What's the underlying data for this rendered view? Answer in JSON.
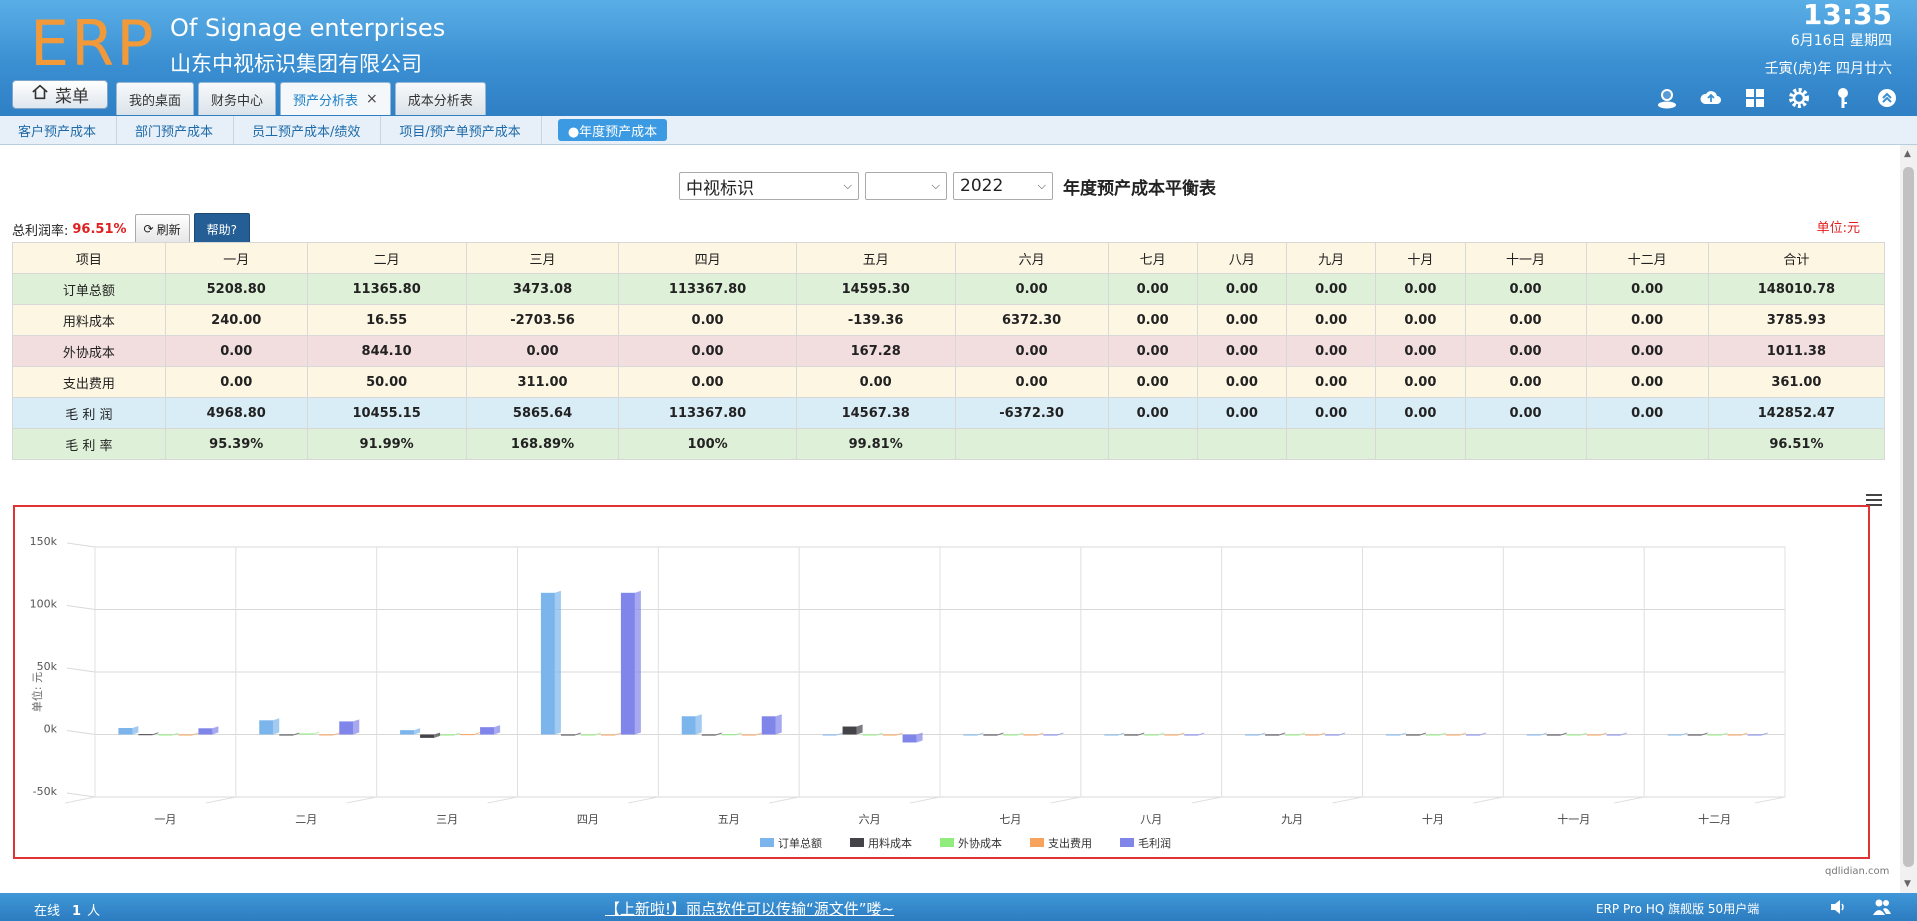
{
  "header": {
    "logo": "ERP",
    "company_en": "Of Signage enterprises",
    "company_cn": "山东中视标识集团有限公司",
    "time": "13:35",
    "date": "6月16日 星期四",
    "lunar": "壬寅(虎)年 四月廿六",
    "menu_label": "菜单",
    "tabs": [
      {
        "label": "我的桌面"
      },
      {
        "label": "财务中心"
      },
      {
        "label": "预产分析表",
        "close": "×"
      },
      {
        "label": "成本分析表"
      }
    ],
    "tool_icons": [
      "user-status-icon",
      "cloud-upload-icon",
      "apps-grid-icon",
      "settings-gear-icon",
      "key-icon",
      "collapse-up-icon"
    ]
  },
  "subnav": {
    "items": [
      "客户预产成本",
      "部门预产成本",
      "员工预产成本/绩效",
      "项目/预产单预产成本",
      "●年度预产成本"
    ]
  },
  "filters": {
    "company": "中视标识",
    "second": "",
    "year": "2022",
    "report_title": "年度预产成本平衡表"
  },
  "summary": {
    "label": "总利润率:",
    "rate": "96.51%",
    "refresh_label": "刷新",
    "help_label": "帮助?",
    "unit": "单位:元"
  },
  "table": {
    "headers": [
      "项目",
      "一月",
      "二月",
      "三月",
      "四月",
      "五月",
      "六月",
      "七月",
      "八月",
      "九月",
      "十月",
      "十一月",
      "十二月",
      "合计"
    ],
    "rows": [
      [
        "订单总额",
        "5208.80",
        "11365.80",
        "3473.08",
        "113367.80",
        "14595.30",
        "0.00",
        "0.00",
        "0.00",
        "0.00",
        "0.00",
        "0.00",
        "0.00",
        "148010.78"
      ],
      [
        "用料成本",
        "240.00",
        "16.55",
        "-2703.56",
        "0.00",
        "-139.36",
        "6372.30",
        "0.00",
        "0.00",
        "0.00",
        "0.00",
        "0.00",
        "0.00",
        "3785.93"
      ],
      [
        "外协成本",
        "0.00",
        "844.10",
        "0.00",
        "0.00",
        "167.28",
        "0.00",
        "0.00",
        "0.00",
        "0.00",
        "0.00",
        "0.00",
        "0.00",
        "1011.38"
      ],
      [
        "支出费用",
        "0.00",
        "50.00",
        "311.00",
        "0.00",
        "0.00",
        "0.00",
        "0.00",
        "0.00",
        "0.00",
        "0.00",
        "0.00",
        "0.00",
        "361.00"
      ],
      [
        "毛 利 润",
        "4968.80",
        "10455.15",
        "5865.64",
        "113367.80",
        "14567.38",
        "-6372.30",
        "0.00",
        "0.00",
        "0.00",
        "0.00",
        "0.00",
        "0.00",
        "142852.47"
      ],
      [
        "毛 利 率",
        "95.39%",
        "91.99%",
        "168.89%",
        "100%",
        "99.81%",
        "",
        "",
        "",
        "",
        "",
        "",
        "",
        "96.51%"
      ]
    ]
  },
  "chart_data": {
    "type": "bar",
    "categories": [
      "一月",
      "二月",
      "三月",
      "四月",
      "五月",
      "六月",
      "七月",
      "八月",
      "九月",
      "十月",
      "十一月",
      "十二月"
    ],
    "ylabel": "单位: 元",
    "ylim": [
      -50000,
      150000
    ],
    "yticks": [
      "150k",
      "100k",
      "50k",
      "0k",
      "-50k"
    ],
    "yticks_values": [
      150000,
      100000,
      50000,
      0,
      -50000
    ],
    "series": [
      {
        "name": "订单总额",
        "color": "#7cb5ec",
        "values": [
          5208.8,
          11365.8,
          3473.08,
          113367.8,
          14595.3,
          0,
          0,
          0,
          0,
          0,
          0,
          0
        ]
      },
      {
        "name": "用料成本",
        "color": "#434348",
        "values": [
          240,
          16.55,
          -2703.56,
          0,
          -139.36,
          6372.3,
          0,
          0,
          0,
          0,
          0,
          0
        ]
      },
      {
        "name": "外协成本",
        "color": "#90ed7d",
        "values": [
          0,
          844.1,
          0,
          0,
          167.28,
          0,
          0,
          0,
          0,
          0,
          0,
          0
        ]
      },
      {
        "name": "支出费用",
        "color": "#f7a35c",
        "values": [
          0,
          50,
          311,
          0,
          0,
          0,
          0,
          0,
          0,
          0,
          0,
          0
        ]
      },
      {
        "name": "毛利润",
        "color": "#8085e9",
        "values": [
          4968.8,
          10455.15,
          5865.64,
          113367.8,
          14567.38,
          -6372.3,
          0,
          0,
          0,
          0,
          0,
          0
        ]
      }
    ],
    "legend_position": "bottom-center",
    "grid": true
  },
  "footer": {
    "online_label": "在线",
    "online_count": "1",
    "online_unit": "人",
    "news": "【上新啦!】丽点软件可以传输“源文件”喽~",
    "version": "ERP Pro HQ 旗舰版 50用户端",
    "credit": "qdlidian.com"
  }
}
